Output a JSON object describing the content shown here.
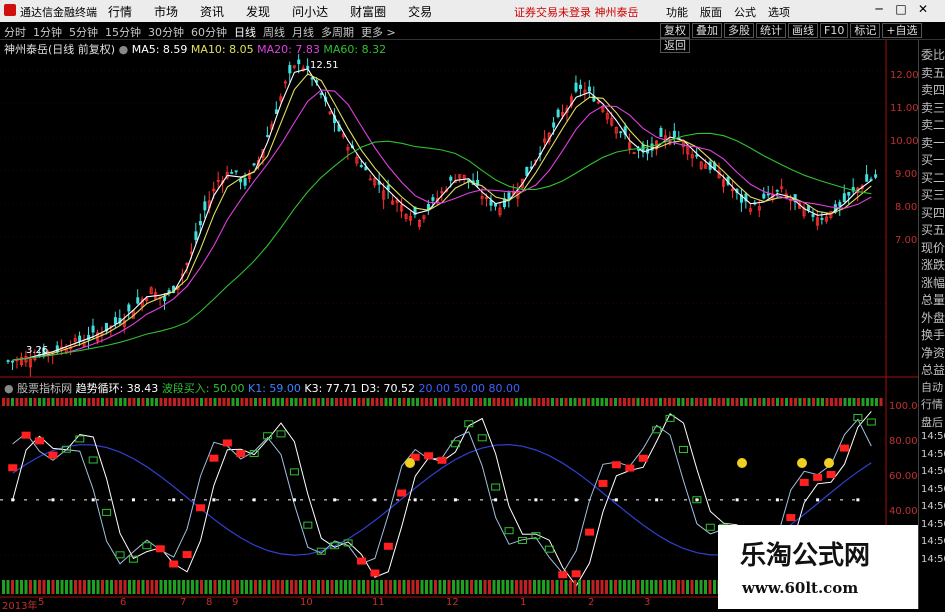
{
  "titlebar": {
    "app_name": "通达信金融终端",
    "menu": [
      "行情",
      "市场",
      "资讯",
      "发现",
      "问小达",
      "财富圈",
      "交易"
    ],
    "notice": "证券交易未登录  神州泰岳",
    "right_menu": [
      "功能",
      "版面",
      "公式",
      "选项"
    ],
    "window_buttons": [
      "─",
      "□",
      "✕"
    ]
  },
  "toolbar": {
    "periods": [
      "分时",
      "1分钟",
      "5分钟",
      "15分钟",
      "30分钟",
      "60分钟",
      "日线",
      "周线",
      "月线",
      "多周期",
      "更多 >"
    ],
    "active_period": "日线",
    "right_buttons": [
      "复权",
      "叠加",
      "多股",
      "统计",
      "画线",
      "F10",
      "标记",
      "+自选",
      "返回"
    ]
  },
  "chart_header": {
    "stock_name": "神州泰岳(日线 前复权)",
    "ma5": "MA5: 8.59",
    "ma10": "MA10: 8.05",
    "ma20": "MA20: 7.83",
    "ma60": "MA60: 8.32",
    "max_label": "12.51",
    "min_label": "3.26"
  },
  "indicator_header": {
    "name": "股票指标网",
    "trend_label": "趋势循环: 38.43",
    "band_label": "波段买入: 50.00",
    "k1": "K1: 59.00",
    "k3": "K3: 77.71",
    "d3": "D3: 70.52",
    "v1": "20.00",
    "v2": "50.00",
    "v3": "80.00"
  },
  "right_panel": [
    "委比",
    "卖五",
    "卖四",
    "卖三",
    "卖二",
    "卖一",
    "买一",
    "买二",
    "买三",
    "买四",
    "买五",
    "现价",
    "涨跌",
    "涨幅",
    "总量",
    "外盘",
    "换手",
    "净资",
    "总益",
    "自动",
    "行情",
    "盘后",
    "14:50",
    "14:50",
    "14:50",
    "14:50",
    "14:50",
    "14:50",
    "14:50",
    "14:50"
  ],
  "price_axis": [
    "12.00",
    "11.00",
    "10.00",
    "9.00",
    "8.00",
    "7.00"
  ],
  "indicator_axis": [
    "100.0",
    "80.00",
    "60.00",
    "40.00"
  ],
  "time_axis": [
    "2013年",
    "5",
    "6",
    "7",
    "8",
    "9",
    "10",
    "11",
    "12",
    "1",
    "2",
    "3"
  ],
  "watermark": {
    "title": "乐淘公式网",
    "url": "www.60lt.com"
  },
  "colors": {
    "up": "#ff3030",
    "down": "#40e0e0",
    "ma5": "#ffffff",
    "ma10": "#e0e060",
    "ma20": "#e040e0",
    "ma60": "#30c030"
  },
  "chart_data": {
    "type": "candlestick",
    "price_range": [
      3.0,
      12.8
    ],
    "closes": [
      3.3,
      3.4,
      3.5,
      3.6,
      3.8,
      3.9,
      4.1,
      4.3,
      4.6,
      5.0,
      5.4,
      5.1,
      5.6,
      6.5,
      7.8,
      8.7,
      9.0,
      8.6,
      9.3,
      10.4,
      11.6,
      12.3,
      11.8,
      11.0,
      10.2,
      9.6,
      9.0,
      8.6,
      8.2,
      7.8,
      7.6,
      8.0,
      8.5,
      8.9,
      8.6,
      8.1,
      7.9,
      8.3,
      8.9,
      9.6,
      10.3,
      10.9,
      11.5,
      11.2,
      10.8,
      10.2,
      9.6,
      9.5,
      9.9,
      10.1,
      9.7,
      9.3,
      9.0,
      8.6,
      8.1,
      7.9,
      8.2,
      8.4,
      8.0,
      7.7,
      7.6,
      7.8,
      8.2,
      8.6,
      8.8
    ]
  }
}
